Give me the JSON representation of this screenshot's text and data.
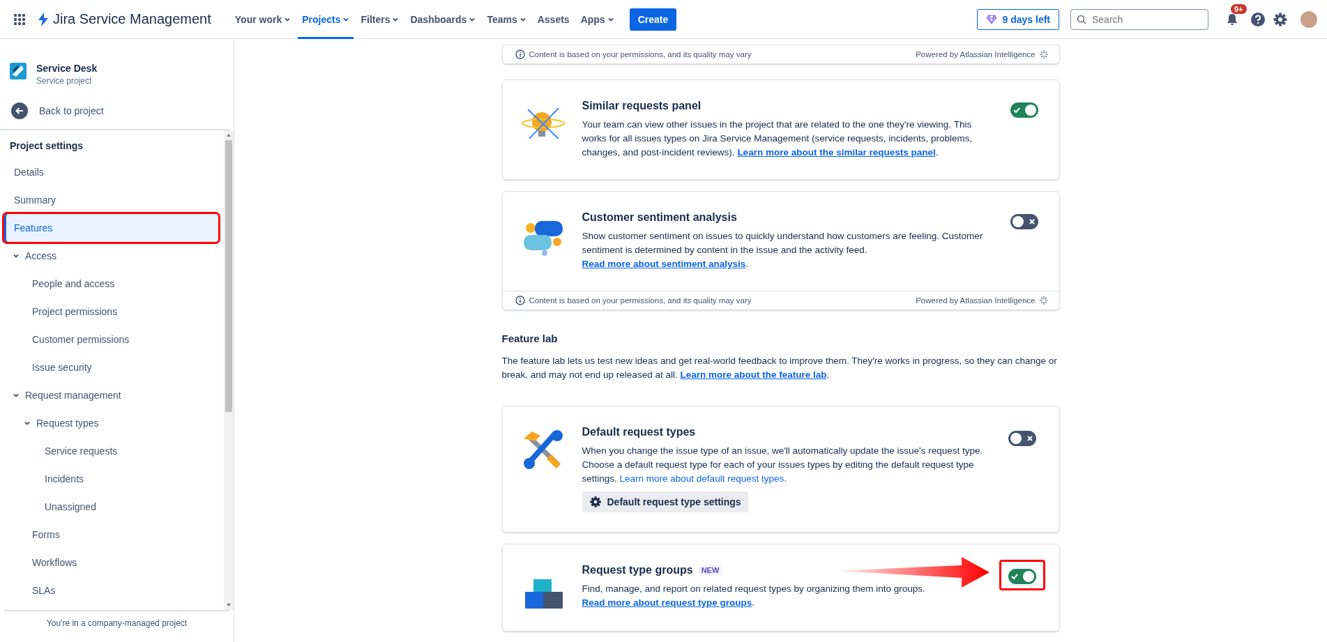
{
  "topbar": {
    "product": "Jira Service Management",
    "nav": [
      {
        "label": "Your work",
        "dropdown": true,
        "selected": false
      },
      {
        "label": "Projects",
        "dropdown": true,
        "selected": true
      },
      {
        "label": "Filters",
        "dropdown": true,
        "selected": false
      },
      {
        "label": "Dashboards",
        "dropdown": true,
        "selected": false
      },
      {
        "label": "Teams",
        "dropdown": true,
        "selected": false
      },
      {
        "label": "Assets",
        "dropdown": false,
        "selected": false
      },
      {
        "label": "Apps",
        "dropdown": true,
        "selected": false
      }
    ],
    "create": "Create",
    "trial": "9 days left",
    "search": {
      "placeholder": "Search"
    },
    "notifications_badge": "9+"
  },
  "sidebar": {
    "project": {
      "name": "Service Desk",
      "type": "Service project"
    },
    "back": "Back to project",
    "heading": "Project settings",
    "items": [
      {
        "label": "Details",
        "selected": false,
        "annotated": false
      },
      {
        "label": "Summary",
        "selected": false,
        "annotated": false
      },
      {
        "label": "Features",
        "selected": true,
        "annotated": true
      },
      {
        "label": "Access",
        "selected": false,
        "annotated": false,
        "expanded": true,
        "children": [
          {
            "label": "People and access",
            "selected": false
          },
          {
            "label": "Project permissions",
            "selected": false
          },
          {
            "label": "Customer permissions",
            "selected": false
          },
          {
            "label": "Issue security",
            "selected": false
          }
        ]
      },
      {
        "label": "Request management",
        "selected": false,
        "annotated": false,
        "expanded": true,
        "children": [
          {
            "label": "Request types",
            "selected": false,
            "expanded": true,
            "children": [
              {
                "label": "Service requests",
                "selected": false
              },
              {
                "label": "Incidents",
                "selected": false
              },
              {
                "label": "Unassigned",
                "selected": false
              }
            ]
          },
          {
            "label": "Forms",
            "selected": false
          },
          {
            "label": "Workflows",
            "selected": false
          },
          {
            "label": "SLAs",
            "selected": false
          }
        ]
      }
    ],
    "footer": "You're in a company-managed project"
  },
  "cards": [
    {
      "kind": "footer_only",
      "footer": {
        "note": "Content is based on your permissions, and its quality may vary",
        "powered": "Powered by Atlassian Intelligence"
      }
    },
    {
      "kind": "feature",
      "title": "Similar requests panel",
      "description": "Your team can view other issues in the project that are related to the one they're viewing. This works for all issues types on Jira Service Management (service requests, incidents, problems, changes, and post-incident reviews). ",
      "link": "Learn more about the similar requests panel",
      "link_end": ".",
      "link_underlined": true,
      "link_on_new_line": false,
      "on": true
    },
    {
      "kind": "feature",
      "title": "Customer sentiment analysis",
      "description": "Show customer sentiment on issues to quickly understand how customers are feeling. Customer sentiment is determined by content in the issue and the activity feed.",
      "link": "Read more about sentiment analysis",
      "link_end": ".",
      "link_underlined": true,
      "link_on_new_line": true,
      "on": false,
      "footer": {
        "note": "Content is based on your permissions, and its quality may vary",
        "powered": "Powered by Atlassian Intelligence"
      }
    }
  ],
  "feature_lab": {
    "heading": "Feature lab",
    "text": "The feature lab lets us test new ideas and get real-world feedback to improve them. They're works in progress, so they can change or break, and may not end up released at all. ",
    "link": "Learn more about the feature lab",
    "link_end": "."
  },
  "lab_cards": [
    {
      "kind": "feature",
      "title": "Default request types",
      "description": "When you change the issue type of an issue, we'll automatically update the issue's request type. Choose a default request type for each of your issues types by editing the default request type settings. ",
      "link": "Learn more about default request types",
      "link_end": ".",
      "link_underlined": false,
      "link_on_new_line": false,
      "button": "Default request type settings",
      "on": false,
      "annotated": false
    },
    {
      "kind": "feature",
      "title": "Request type groups",
      "badge": "NEW",
      "description": "Find, manage, and report on related request types by organizing them into groups.",
      "link": "Read more about request type groups",
      "link_end": ".",
      "link_underlined": true,
      "link_on_new_line": true,
      "on": true,
      "annotated": true
    }
  ]
}
